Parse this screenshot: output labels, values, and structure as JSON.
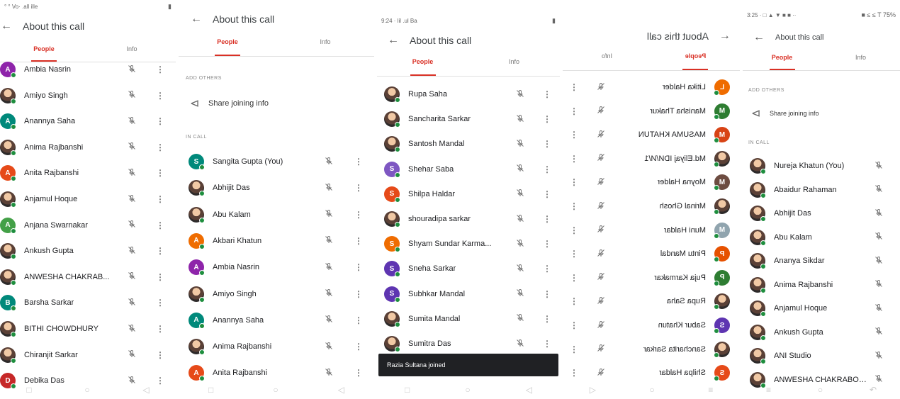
{
  "screens": [
    {
      "status_left": "° ° Vo· .all illе",
      "title": "About this call",
      "tabs": [
        "People",
        "Info"
      ],
      "participants": [
        {
          "name": "Ambia Nasrin",
          "initial": "A",
          "color": "#8e24aa"
        },
        {
          "name": "Amiyo Singh",
          "initial": "",
          "color": "#3949ab"
        },
        {
          "name": "Anannya Saha",
          "initial": "A",
          "color": "#00897b"
        },
        {
          "name": "Anima Rajbanshi",
          "initial": "",
          "color": "#d9a38a"
        },
        {
          "name": "Anita Rajbanshi",
          "initial": "A",
          "color": "#e64a19"
        },
        {
          "name": "Anjamul Hoque",
          "initial": "",
          "color": "#f3c2a0"
        },
        {
          "name": "Anjana Swarnakar",
          "initial": "A",
          "color": "#43a047"
        },
        {
          "name": "Ankush Gupta",
          "initial": "",
          "color": "#5c6bc0"
        },
        {
          "name": "ANWESHA CHAKRAB...",
          "initial": "",
          "color": "#8d6e63"
        },
        {
          "name": "Barsha Sarkar",
          "initial": "B",
          "color": "#00897b"
        },
        {
          "name": "BITHI CHOWDHURY",
          "initial": "",
          "color": "#c0a080"
        },
        {
          "name": "Chiranjit Sarkar",
          "initial": "",
          "color": "#6d4c41"
        },
        {
          "name": "Debika Das",
          "initial": "D",
          "color": "#c62828"
        }
      ]
    },
    {
      "title": "About this call",
      "tabs": [
        "People",
        "Info"
      ],
      "add_others_label": "ADD OTHERS",
      "share_label": "Share joining info",
      "in_call_label": "IN CALL",
      "participants": [
        {
          "name": "Sangita Gupta (You)",
          "initial": "S",
          "color": "#00897b"
        },
        {
          "name": "Abhijit Das",
          "initial": "",
          "color": "#b08a60"
        },
        {
          "name": "Abu Kalam",
          "initial": "",
          "color": "#78909c"
        },
        {
          "name": "Akbari Khatun",
          "initial": "A",
          "color": "#ef6c00"
        },
        {
          "name": "Ambia Nasrin",
          "initial": "A",
          "color": "#8e24aa"
        },
        {
          "name": "Amiyo Singh",
          "initial": "",
          "color": "#3949ab"
        },
        {
          "name": "Anannya Saha",
          "initial": "A",
          "color": "#00897b"
        },
        {
          "name": "Anima Rajbanshi",
          "initial": "",
          "color": "#d9a38a"
        },
        {
          "name": "Anita Rajbanshi",
          "initial": "A",
          "color": "#e64a19"
        }
      ]
    },
    {
      "status_left": "9:24 · lil .ul Ba",
      "title": "About this call",
      "tabs": [
        "People",
        "Info"
      ],
      "participants": [
        {
          "name": "Rupa Saha",
          "initial": "",
          "color": "#5d4037"
        },
        {
          "name": "Sancharita Sarkar",
          "initial": "",
          "color": "#c62828"
        },
        {
          "name": "Santosh Mandal",
          "initial": "",
          "color": "#f6a93b"
        },
        {
          "name": "Shehar Saba",
          "initial": "S",
          "color": "#7e57c2"
        },
        {
          "name": "Shilpa Haldar",
          "initial": "S",
          "color": "#e64a19"
        },
        {
          "name": "shouradipa sarkar",
          "initial": "",
          "color": "#8d8d8d"
        },
        {
          "name": "Shyam Sundar Karma...",
          "initial": "S",
          "color": "#ef6c00"
        },
        {
          "name": "Sneha Sarkar",
          "initial": "S",
          "color": "#5e35b1"
        },
        {
          "name": "Subhkar Mandal",
          "initial": "S",
          "color": "#5e35b1"
        },
        {
          "name": "Sumita Mandal",
          "initial": "",
          "color": "#4e342e"
        },
        {
          "name": "Sumitra Das",
          "initial": "",
          "color": "#795548"
        }
      ],
      "toast": "Razia Sultana joined"
    },
    {
      "title": "About this call",
      "tabs": [
        "People",
        "Info"
      ],
      "participants": [
        {
          "name": "Litika Halder",
          "initial": "L",
          "color": "#ef6c00"
        },
        {
          "name": "Manisha Thakur",
          "initial": "M",
          "color": "#2e7d32"
        },
        {
          "name": "MASUMA KHATUN",
          "initial": "M",
          "color": "#d84315"
        },
        {
          "name": "Md.Eliyaj IDИ/И/1",
          "initial": "",
          "color": "#6d4c41"
        },
        {
          "name": "Moyna Halder",
          "initial": "M",
          "color": "#6d4c41"
        },
        {
          "name": "Mrinal Ghosh",
          "initial": "",
          "color": "#212121"
        },
        {
          "name": "Muni Haldar",
          "initial": "M",
          "color": "#90a4ae"
        },
        {
          "name": "Pintu Mandal",
          "initial": "P",
          "color": "#e65100"
        },
        {
          "name": "Puja Karmakar",
          "initial": "P",
          "color": "#2e7d32"
        },
        {
          "name": "Rupa Saha",
          "initial": "",
          "color": "#5d4037"
        },
        {
          "name": "Sabur Khatun",
          "initial": "S",
          "color": "#5e35b1"
        },
        {
          "name": "Sancharita Sarkar",
          "initial": "",
          "color": "#c62828"
        },
        {
          "name": "Shilpa Haldar",
          "initial": "S",
          "color": "#e64a19"
        }
      ]
    },
    {
      "status_left": "3:25 · □ ▲ ▼ ■ ■ ··",
      "status_right": "■ ≤ ≤ T 75%",
      "title": "About this call",
      "tabs": [
        "People",
        "Info"
      ],
      "add_others_label": "ADD OTHERS",
      "share_label": "Share joining info",
      "in_call_label": "IN CALL",
      "participants": [
        {
          "name": "Nureja Khatun (You)",
          "initial": "",
          "color": "#8d6e63"
        },
        {
          "name": "Abaidur Rahaman",
          "initial": "",
          "color": "#6d4c41"
        },
        {
          "name": "Abhijit Das",
          "initial": "",
          "color": "#b08a60"
        },
        {
          "name": "Abu Kalam",
          "initial": "",
          "color": "#78909c"
        },
        {
          "name": "Ananya Sikdar",
          "initial": "",
          "color": "#4e342e"
        },
        {
          "name": "Anima Rajbanshi",
          "initial": "",
          "color": "#d9a38a"
        },
        {
          "name": "Anjamul Hoque",
          "initial": "",
          "color": "#f3c2a0"
        },
        {
          "name": "Ankush Gupta",
          "initial": "",
          "color": "#5c6bc0"
        },
        {
          "name": "ANI Studio",
          "initial": "",
          "color": "#455a64"
        },
        {
          "name": "ANWESHA CHAKRABOR...",
          "initial": "",
          "color": "#8d6e63"
        }
      ]
    }
  ],
  "icons": {
    "back": "arrow-left-icon",
    "mic_off": "mic-off-icon",
    "more": "more-vert-icon",
    "share": "share-icon"
  }
}
